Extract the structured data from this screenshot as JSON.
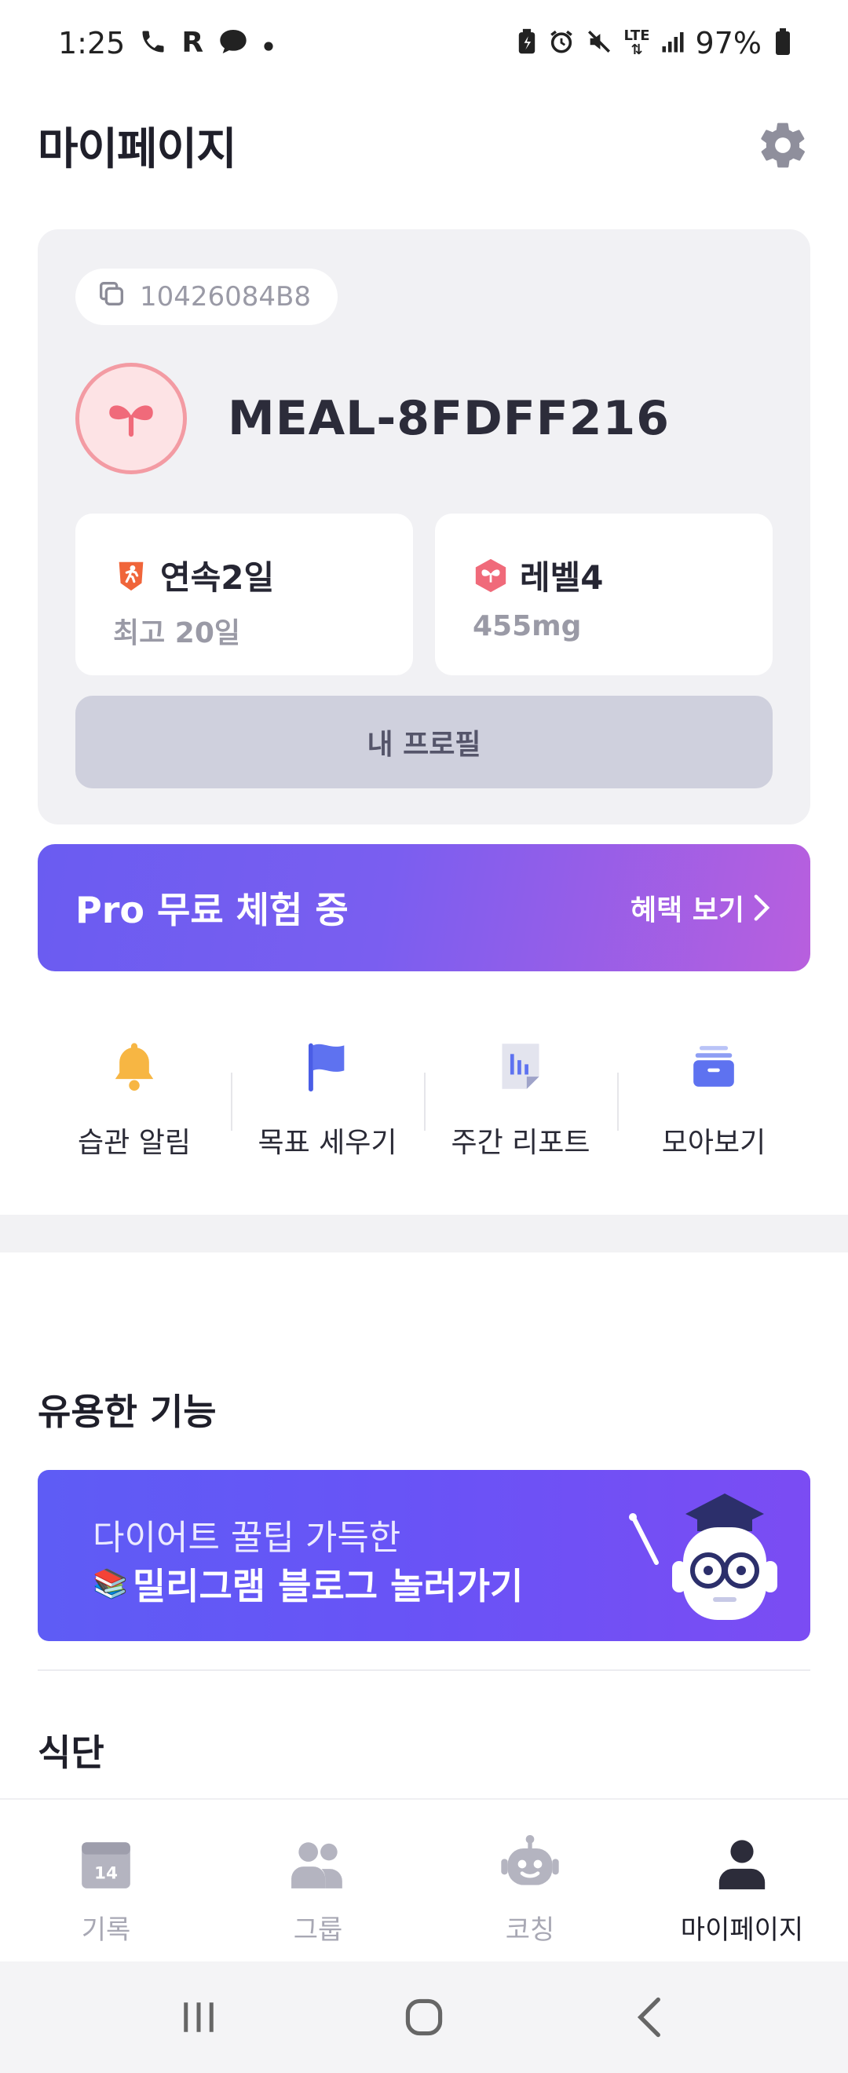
{
  "status_bar": {
    "time": "1:25",
    "left_icons": [
      "call-icon",
      "r-icon",
      "chat-bubble-icon",
      "dot-icon"
    ],
    "right_icons": [
      "battery-saver-icon",
      "alarm-icon",
      "mute-icon",
      "lte-icon",
      "signal-icon"
    ],
    "battery": "97%"
  },
  "header": {
    "title": "마이페이지",
    "settings_icon": "gear-icon"
  },
  "profile": {
    "id_code": "10426084B8",
    "copy_icon": "copy-icon",
    "username": "MEAL-8FDFF216",
    "streak": {
      "label": "연속2일",
      "sub": "최고 20일",
      "icon": "running-icon",
      "color": "#f0653a"
    },
    "level": {
      "label": "레벨4",
      "sub": "455mg",
      "icon": "level-badge-icon",
      "color": "#f06a7a"
    },
    "profile_button": "내 프로필"
  },
  "pro_banner": {
    "title": "Pro 무료 체험 중",
    "link": "혜택 보기",
    "gradient": [
      "#6a5cf1",
      "#b85fde"
    ]
  },
  "quick_menu": [
    {
      "label": "습관 알림",
      "icon": "bell-icon"
    },
    {
      "label": "목표 세우기",
      "icon": "flag-icon"
    },
    {
      "label": "주간 리포트",
      "icon": "report-icon"
    },
    {
      "label": "모아보기",
      "icon": "archive-box-icon"
    }
  ],
  "useful": {
    "title": "유용한 기능",
    "blog_banner": {
      "line1": "다이어트 꿀팁 가득한",
      "line2": "밀리그램 블로그 놀러가기",
      "emoji": "📚"
    }
  },
  "meal_section": {
    "title": "식단"
  },
  "bottom_nav": [
    {
      "label": "기록",
      "icon": "calendar-icon",
      "badge": "14",
      "active": false
    },
    {
      "label": "그룹",
      "icon": "group-icon",
      "active": false
    },
    {
      "label": "코칭",
      "icon": "robot-icon",
      "active": false
    },
    {
      "label": "마이페이지",
      "icon": "person-icon",
      "active": true
    }
  ],
  "colors": {
    "accent": "#6a5cf1",
    "card_bg": "#f1f1f4",
    "button_bg": "#cfd0dd",
    "inactive_nav": "#a8a8b4"
  }
}
